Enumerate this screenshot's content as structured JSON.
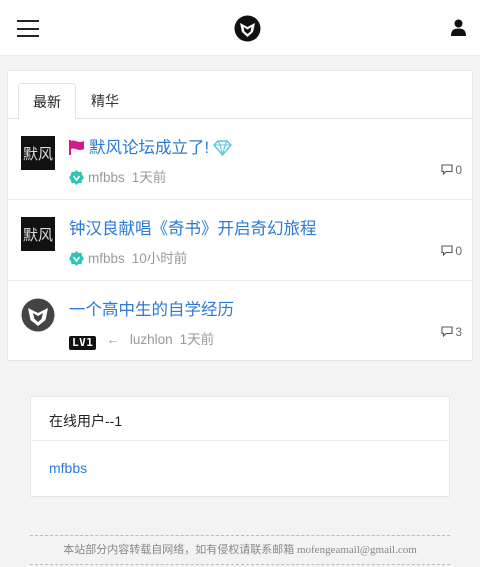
{
  "header": {
    "menu_icon": "hamburger-menu-icon",
    "logo_icon": "fox-logo-icon",
    "user_icon": "user-icon"
  },
  "tabs": [
    {
      "label": "最新",
      "active": true
    },
    {
      "label": "精华",
      "active": false
    }
  ],
  "threads": [
    {
      "title": "默风论坛成立了!",
      "title_icon_before": "flag-icon",
      "title_icon_after": "diamond-icon",
      "avatar": "calligraphy-avatar",
      "author_badge": "verified-icon",
      "author": "mfbbs",
      "time": "1天前",
      "reply_count": "0"
    },
    {
      "title": "钟汉良献唱《奇书》开启奇幻旅程",
      "avatar": "calligraphy-avatar",
      "author_badge": "verified-icon",
      "author": "mfbbs",
      "time": "10小时前",
      "reply_count": "0"
    },
    {
      "title": "一个高中生的自学经历",
      "avatar": "fox-avatar",
      "level_badge": "LV1",
      "arrow": "←",
      "author": "luzhlon",
      "time": "1天前",
      "reply_count": "3"
    }
  ],
  "online": {
    "title": "在线用户--1",
    "users": [
      "mfbbs"
    ]
  },
  "footer": {
    "text": "本站部分内容转载自网络，如有侵权请联系邮箱 mofengeamail@gmail.com"
  },
  "colors": {
    "link": "#2a7ad6",
    "flag": "#d6198a",
    "diamond": "#5ec8e6",
    "verified": "#2ec4b6"
  }
}
